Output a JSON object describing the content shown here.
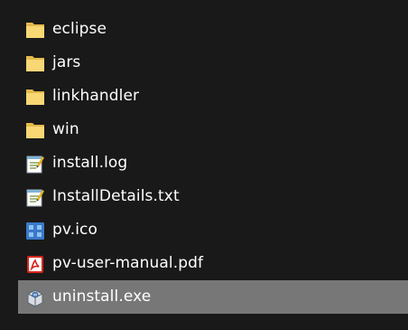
{
  "files": [
    {
      "name": "eclipse",
      "icon": "folder-icon"
    },
    {
      "name": "jars",
      "icon": "folder-icon"
    },
    {
      "name": "linkhandler",
      "icon": "folder-icon"
    },
    {
      "name": "win",
      "icon": "folder-icon"
    },
    {
      "name": "install.log",
      "icon": "text-file-icon"
    },
    {
      "name": "InstallDetails.txt",
      "icon": "text-file-icon"
    },
    {
      "name": "pv.ico",
      "icon": "ico-file-icon"
    },
    {
      "name": "pv-user-manual.pdf",
      "icon": "pdf-file-icon"
    },
    {
      "name": "uninstall.exe",
      "icon": "installer-exe-icon",
      "selected": true
    }
  ],
  "colors": {
    "background": "#191919",
    "selection": "#777777",
    "folder": "#f8d775",
    "text": "#ffffff"
  }
}
